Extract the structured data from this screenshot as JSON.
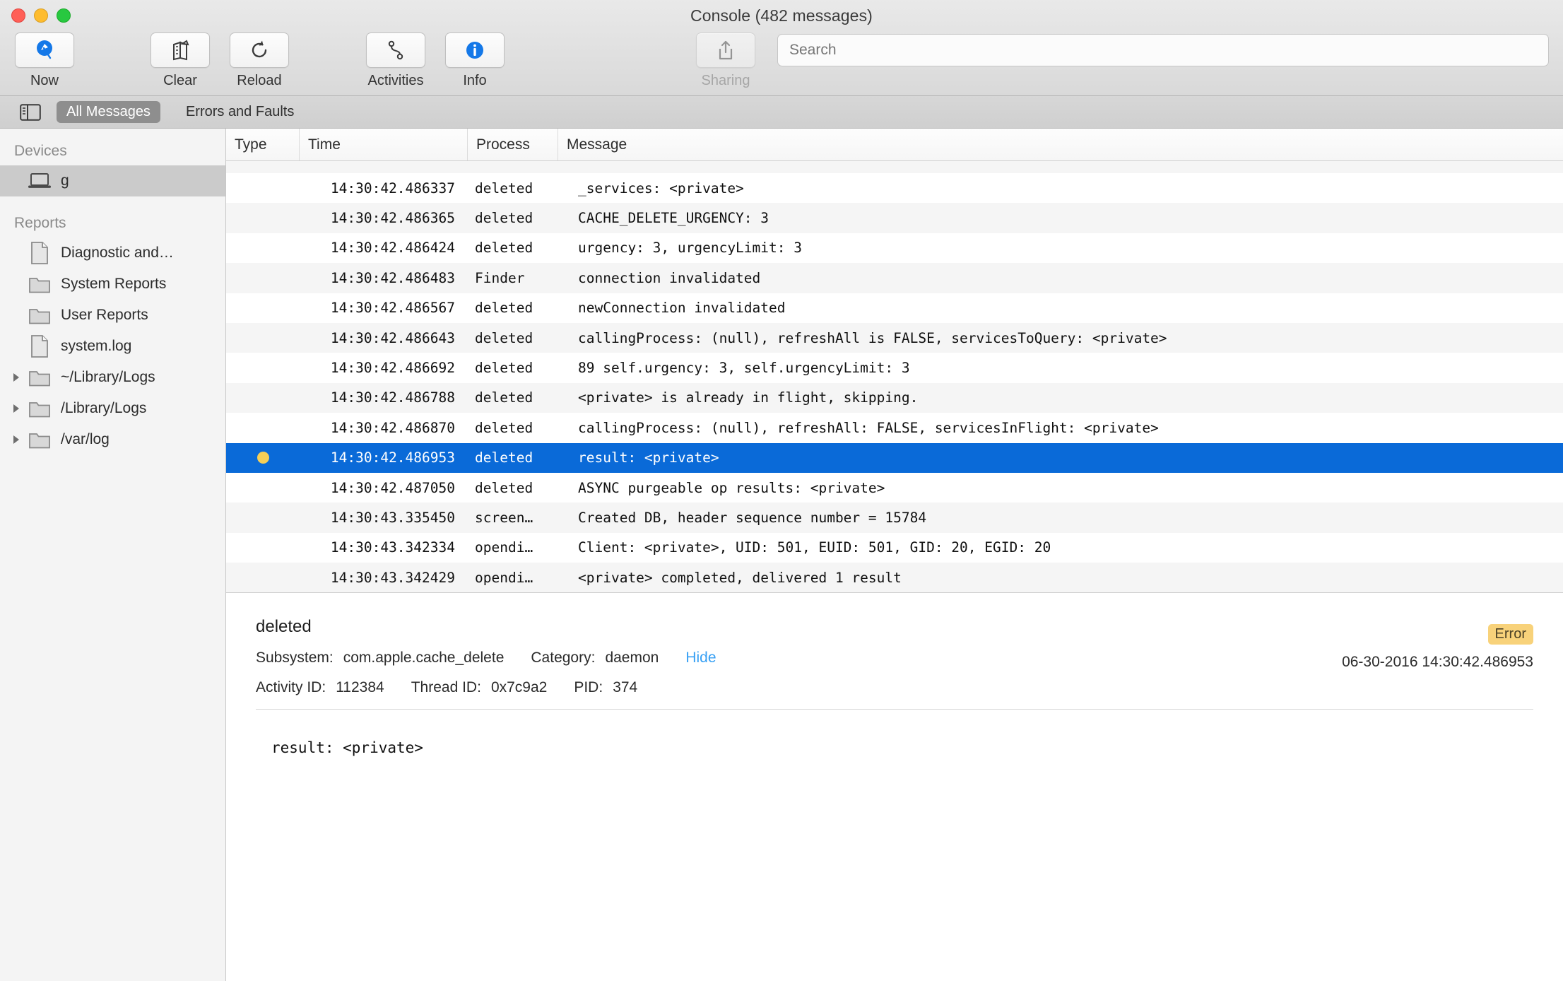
{
  "window": {
    "title": "Console (482 messages)",
    "traffic_lights": [
      "close",
      "minimize",
      "maximize"
    ]
  },
  "toolbar": {
    "items": [
      {
        "label": "Now",
        "icon": "now-icon",
        "disabled": false
      },
      {
        "label": "Clear",
        "icon": "clear-icon",
        "disabled": false
      },
      {
        "label": "Reload",
        "icon": "reload-icon",
        "disabled": false
      },
      {
        "label": "Activities",
        "icon": "activities-icon",
        "disabled": false
      },
      {
        "label": "Info",
        "icon": "info-icon",
        "disabled": false
      },
      {
        "label": "Sharing",
        "icon": "share-icon",
        "disabled": true
      }
    ],
    "search": {
      "placeholder": "Search",
      "value": ""
    }
  },
  "filterbar": {
    "sidebar_toggle_icon": "sidebar-toggle-icon",
    "segments": [
      {
        "label": "All Messages",
        "selected": true
      },
      {
        "label": "Errors and Faults",
        "selected": false
      }
    ]
  },
  "sidebar": {
    "sections": [
      {
        "header": "Devices",
        "items": [
          {
            "label": "g",
            "icon": "laptop-icon",
            "selected": true,
            "twisty": false
          }
        ]
      },
      {
        "header": "Reports",
        "items": [
          {
            "label": "Diagnostic and…",
            "icon": "document-icon",
            "selected": false,
            "twisty": false
          },
          {
            "label": "System Reports",
            "icon": "folder-icon",
            "selected": false,
            "twisty": false
          },
          {
            "label": "User Reports",
            "icon": "folder-icon",
            "selected": false,
            "twisty": false
          },
          {
            "label": "system.log",
            "icon": "document-icon",
            "selected": false,
            "twisty": false
          },
          {
            "label": "~/Library/Logs",
            "icon": "folder-icon",
            "selected": false,
            "twisty": true
          },
          {
            "label": "/Library/Logs",
            "icon": "folder-icon",
            "selected": false,
            "twisty": true
          },
          {
            "label": "/var/log",
            "icon": "folder-icon",
            "selected": false,
            "twisty": true
          }
        ]
      }
    ]
  },
  "table": {
    "columns": [
      "Type",
      "Time",
      "Process",
      "Message"
    ],
    "rows": [
      {
        "type": "",
        "time": "",
        "process": "",
        "message": "",
        "selected": false,
        "clipped": true
      },
      {
        "type": "",
        "time": "14:30:42.486337",
        "process": "deleted",
        "message": "_services: <private>",
        "selected": false
      },
      {
        "type": "",
        "time": "14:30:42.486365",
        "process": "deleted",
        "message": "CACHE_DELETE_URGENCY: 3",
        "selected": false
      },
      {
        "type": "",
        "time": "14:30:42.486424",
        "process": "deleted",
        "message": "urgency: 3, urgencyLimit: 3",
        "selected": false
      },
      {
        "type": "",
        "time": "14:30:42.486483",
        "process": "Finder",
        "message": "connection invalidated",
        "selected": false
      },
      {
        "type": "",
        "time": "14:30:42.486567",
        "process": "deleted",
        "message": "newConnection invalidated",
        "selected": false
      },
      {
        "type": "",
        "time": "14:30:42.486643",
        "process": "deleted",
        "message": "callingProcess: (null), refreshAll is FALSE, servicesToQuery: <private>",
        "selected": false
      },
      {
        "type": "",
        "time": "14:30:42.486692",
        "process": "deleted",
        "message": "89 self.urgency: 3, self.urgencyLimit: 3",
        "selected": false
      },
      {
        "type": "",
        "time": "14:30:42.486788",
        "process": "deleted",
        "message": "<private> is already in flight, skipping.",
        "selected": false
      },
      {
        "type": "",
        "time": "14:30:42.486870",
        "process": "deleted",
        "message": "callingProcess: (null), refreshAll: FALSE, servicesInFlight: <private>",
        "selected": false
      },
      {
        "type": "error-dot",
        "time": "14:30:42.486953",
        "process": "deleted",
        "message": "result: <private>",
        "selected": true
      },
      {
        "type": "",
        "time": "14:30:42.487050",
        "process": "deleted",
        "message": "ASYNC purgeable op results: <private>",
        "selected": false
      },
      {
        "type": "",
        "time": "14:30:43.335450",
        "process": "screen…",
        "message": "Created DB, header sequence number = 15784",
        "selected": false
      },
      {
        "type": "",
        "time": "14:30:43.342334",
        "process": "opendi…",
        "message": "Client: <private>, UID: 501, EUID: 501, GID: 20, EGID: 20",
        "selected": false
      },
      {
        "type": "",
        "time": "14:30:43.342429",
        "process": "opendi…",
        "message": "<private> completed, delivered 1 result",
        "selected": false
      }
    ]
  },
  "detail": {
    "title": "deleted",
    "subsystem_label": "Subsystem:",
    "subsystem_value": "com.apple.cache_delete",
    "category_label": "Category:",
    "category_value": "daemon",
    "hide_link": "Hide",
    "activity_label": "Activity ID:",
    "activity_value": "112384",
    "thread_label": "Thread ID:",
    "thread_value": "0x7c9a2",
    "pid_label": "PID:",
    "pid_value": "374",
    "badge": "Error",
    "badge_color": "#f8d27a",
    "datetime": "06-30-2016 14:30:42.486953",
    "body": "result: <private>"
  }
}
